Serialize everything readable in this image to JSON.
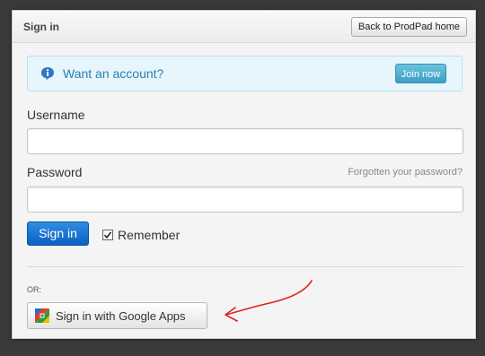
{
  "header": {
    "title": "Sign in",
    "home_button": "Back to ProdPad home"
  },
  "info": {
    "icon": "info-icon",
    "text": "Want an account?",
    "join_button": "Join now"
  },
  "form": {
    "username_label": "Username",
    "username_value": "",
    "password_label": "Password",
    "password_value": "",
    "forgot_link": "Forgotten your password?",
    "signin_button": "Sign in",
    "remember_label": "Remember",
    "remember_checked": true
  },
  "alt": {
    "or_label": "OR:",
    "google_icon": "google-apps-icon",
    "google_button": "Sign in with Google Apps"
  },
  "colors": {
    "primary": "#0b5fc4",
    "info_text": "#2b7fb1",
    "info_bg": "#e6f6fc",
    "join": "#3c9fc4",
    "annotation": "#e02020"
  }
}
